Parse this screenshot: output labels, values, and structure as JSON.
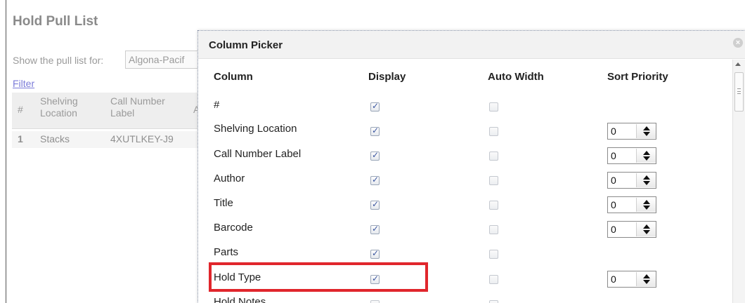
{
  "page": {
    "title": "Hold Pull List",
    "show_label": "Show the pull list for:",
    "library_value": "Algona-Pacif",
    "filter_link": "Filter",
    "grid": {
      "headers": [
        "#",
        "Shelving\nLocation",
        "Call Number\nLabel",
        "A"
      ],
      "row": [
        "1",
        "Stacks",
        "4XUTLKEY-J9"
      ]
    }
  },
  "dialog": {
    "title": "Column Picker",
    "close_icon": "close-icon",
    "headers": {
      "column": "Column",
      "display": "Display",
      "auto_width": "Auto Width",
      "sort_priority": "Sort Priority"
    },
    "rows": [
      {
        "label": "#",
        "display": true,
        "auto_width": false,
        "sort_priority": null
      },
      {
        "label": "Shelving Location",
        "display": true,
        "auto_width": false,
        "sort_priority": "0"
      },
      {
        "label": "Call Number Label",
        "display": true,
        "auto_width": false,
        "sort_priority": "0"
      },
      {
        "label": "Author",
        "display": true,
        "auto_width": false,
        "sort_priority": "0"
      },
      {
        "label": "Title",
        "display": true,
        "auto_width": false,
        "sort_priority": "0"
      },
      {
        "label": "Barcode",
        "display": true,
        "auto_width": false,
        "sort_priority": "0"
      },
      {
        "label": "Parts",
        "display": true,
        "auto_width": false,
        "sort_priority": null
      },
      {
        "label": "Hold Type",
        "display": true,
        "auto_width": false,
        "sort_priority": "0"
      },
      {
        "label": "Hold Notes",
        "display": false,
        "auto_width": false,
        "sort_priority": null
      }
    ],
    "highlighted_row": "Hold Type",
    "highlight_color": "#e0262c"
  }
}
